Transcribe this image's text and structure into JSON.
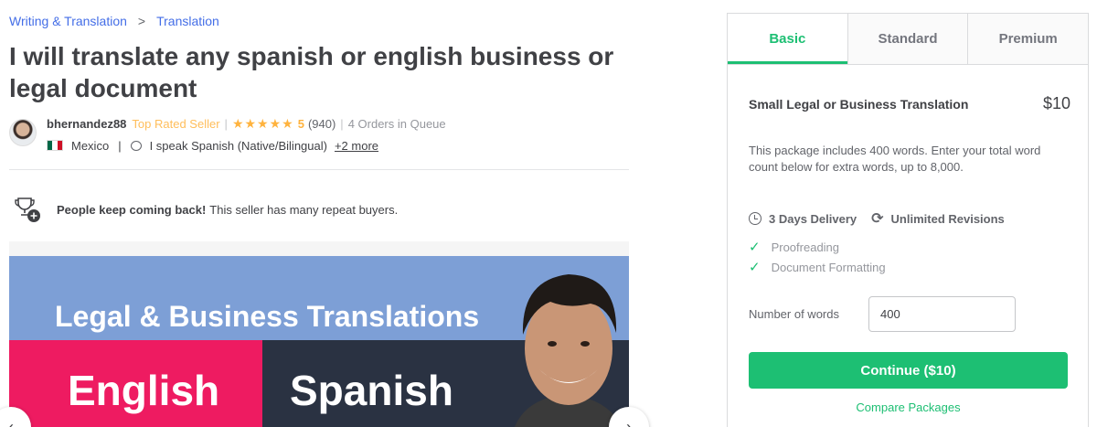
{
  "breadcrumb": {
    "items": [
      "Writing & Translation",
      "Translation"
    ],
    "separator": ">"
  },
  "gig": {
    "title": "I will translate any spanish or english business or legal document"
  },
  "seller": {
    "username": "bhernandez88",
    "level": "Top Rated Seller",
    "stars": "★★★★★",
    "rating": "5",
    "reviews": "(940)",
    "queue": "4 Orders in Queue",
    "country": "Mexico",
    "language": "I speak Spanish (Native/Bilingual)",
    "more_languages": "+2 more"
  },
  "repeat_buyers": {
    "headline": "People keep coming back!",
    "text": "This seller has many repeat buyers."
  },
  "gallery": {
    "headline": "Legal & Business Translations",
    "left_word": "English",
    "right_word": "Spanish",
    "prev_icon": "chevron-left-icon",
    "next_icon": "chevron-right-icon"
  },
  "packages": {
    "tabs": [
      "Basic",
      "Standard",
      "Premium"
    ],
    "active_tab": "Basic",
    "title": "Small Legal or Business Translation",
    "price": "$10",
    "description": "This package includes 400 words. Enter your total word count below for extra words, up to 8,000.",
    "delivery": "3 Days Delivery",
    "revisions": "Unlimited Revisions",
    "features": [
      "Proofreading",
      "Document Formatting"
    ],
    "words_label": "Number of words",
    "words_value": "400",
    "continue_label": "Continue ($10)",
    "compare_label": "Compare Packages"
  },
  "colors": {
    "accent": "#1dbf73",
    "link": "#446ee7",
    "star": "#ffb33e",
    "top_rated": "#ffbe5b",
    "gallery_blue": "#7d9fd6",
    "gallery_pink": "#ee1b61",
    "gallery_navy": "#2a3242"
  }
}
